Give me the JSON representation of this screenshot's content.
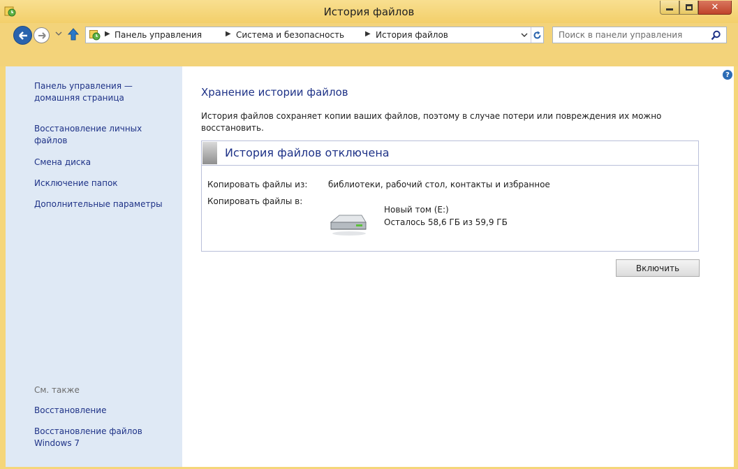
{
  "window": {
    "title": "История файлов"
  },
  "toolbar": {
    "breadcrumbs": [
      "Панель управления",
      "Система и безопасность",
      "История файлов"
    ],
    "search_placeholder": "Поиск в панели управления"
  },
  "sidebar": {
    "links": [
      "Панель управления — домашняя страница",
      "Восстановление личных файлов",
      "Смена диска",
      "Исключение папок",
      "Дополнительные параметры"
    ],
    "see_also_label": "См. также",
    "see_also_links": [
      "Восстановление",
      "Восстановление файлов Windows 7"
    ]
  },
  "main": {
    "title": "Хранение истории файлов",
    "description": "История файлов сохраняет копии ваших файлов, поэтому в случае потери или повреждения их можно восстановить.",
    "status_title": "История файлов отключена",
    "copy_from_label": "Копировать файлы из:",
    "copy_from_value": "библиотеки, рабочий стол, контакты и избранное",
    "copy_to_label": "Копировать файлы в:",
    "drive_name": "Новый том (E:)",
    "drive_space": "Осталось 58,6 ГБ из 59,9 ГБ",
    "enable_button": "Включить"
  },
  "icons": {
    "help": "help-icon",
    "drive": "hard-drive-icon"
  },
  "colors": {
    "accent_link": "#1e3287",
    "title_bar": "#f3cf6a",
    "sidebar_bg": "#dfe9f5",
    "close_button": "#c7472d"
  }
}
